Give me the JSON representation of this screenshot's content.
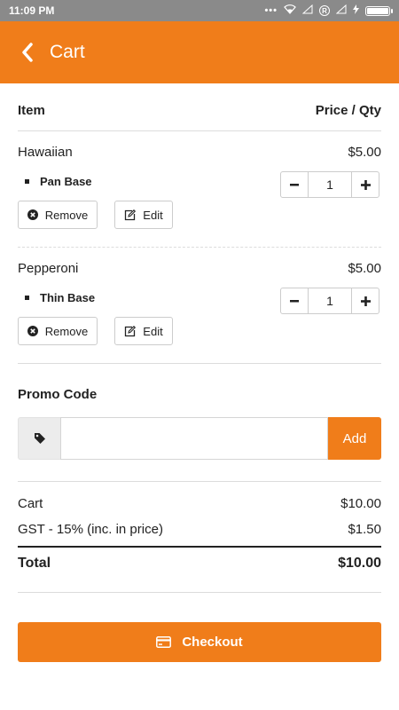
{
  "status": {
    "time": "11:09 PM",
    "battery_level": 1.0
  },
  "header": {
    "title": "Cart"
  },
  "table": {
    "item_header": "Item",
    "price_header": "Price / Qty"
  },
  "items": [
    {
      "name": "Hawaiian",
      "price": "$5.00",
      "option": "Pan Base",
      "qty": "1",
      "remove_label": "Remove",
      "edit_label": "Edit"
    },
    {
      "name": "Pepperoni",
      "price": "$5.00",
      "option": "Thin Base",
      "qty": "1",
      "remove_label": "Remove",
      "edit_label": "Edit"
    }
  ],
  "promo": {
    "label": "Promo Code",
    "value": "",
    "placeholder": "",
    "add_label": "Add"
  },
  "summary": {
    "cart_label": "Cart",
    "cart_value": "$10.00",
    "gst_label": "GST - 15% (inc. in price)",
    "gst_value": "$1.50",
    "total_label": "Total",
    "total_value": "$10.00"
  },
  "checkout": {
    "label": "Checkout"
  },
  "colors": {
    "accent": "#f07d1a",
    "statusbar": "#8a8a8a"
  }
}
